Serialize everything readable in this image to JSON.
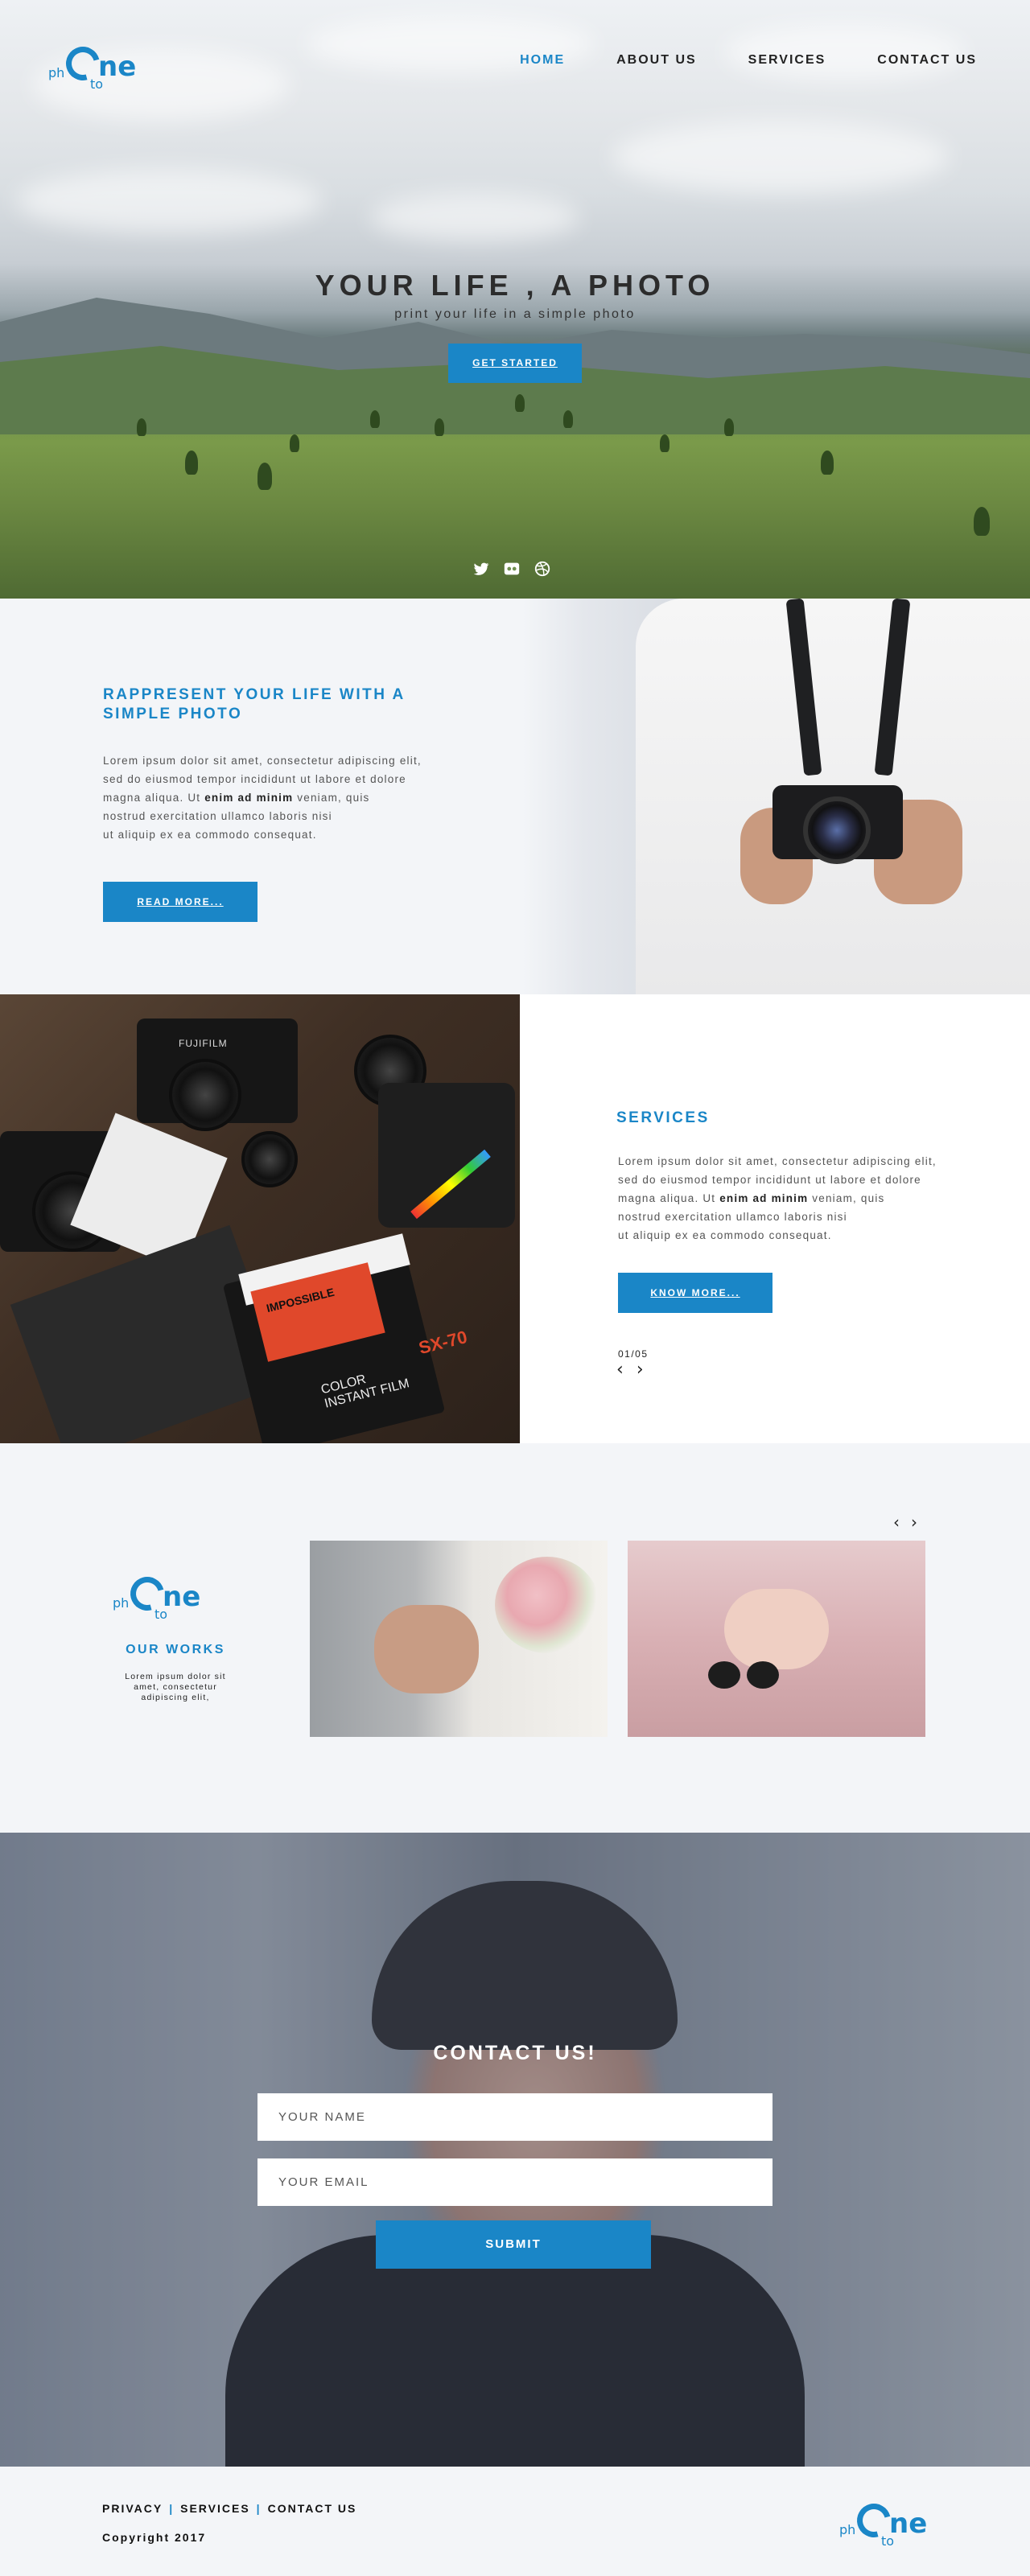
{
  "brand": {
    "logo_letters_main": "ne",
    "logo_ph": "ph",
    "logo_to": "to",
    "accent_color": "#1a86c7"
  },
  "nav": {
    "items": [
      {
        "label": "HOME",
        "active": true
      },
      {
        "label": "ABOUT US",
        "active": false
      },
      {
        "label": "SERVICES",
        "active": false
      },
      {
        "label": "CONTACT US",
        "active": false
      }
    ]
  },
  "hero": {
    "title": "YOUR LIFE , A PHOTO",
    "subtitle": "print your life in a simple photo",
    "cta": "GET STARTED",
    "social_icons": [
      "twitter-icon",
      "flickr-icon",
      "dribbble-icon"
    ]
  },
  "about": {
    "title": "RAPPRESENT YOUR LIFE WITH A SIMPLE PHOTO",
    "text_line1": "Lorem ipsum dolor sit amet, consectetur adipiscing elit,",
    "text_line2": "sed do eiusmod tempor incididunt ut labore et dolore",
    "text_line3_pre": "magna aliqua. Ut ",
    "text_line3_bold": "enim ad minim",
    "text_line3_post": " veniam, quis",
    "text_line4": "nostrud exercitation ullamco laboris nisi",
    "text_line5": "ut aliquip ex ea commodo consequat.",
    "button": "READ MORE..."
  },
  "services": {
    "title": "SERVICES",
    "text_line1": "Lorem ipsum dolor sit amet, consectetur adipiscing elit,",
    "text_line2": "sed do eiusmod tempor incididunt ut labore et dolore",
    "text_line3_pre": "magna aliqua. Ut ",
    "text_line3_bold": "enim ad minim",
    "text_line3_post": " veniam, quis",
    "text_line4": "nostrud exercitation ullamco laboris nisi",
    "text_line5": "ut aliquip ex ea commodo consequat.",
    "button": "KNOW MORE...",
    "pager": "01/05",
    "prev_arrow": "‹",
    "next_arrow": "›",
    "photo_labels": {
      "brand": "FUJIFILM",
      "film_brand": "IMPOSSIBLE",
      "film_model": "SX-70",
      "film_text": "COLOR INSTANT FILM"
    }
  },
  "works": {
    "title": "OUR WORKS",
    "text": "Lorem ipsum dolor sit amet, consectetur adipiscing elit,",
    "prev_arrow": "‹",
    "next_arrow": "›"
  },
  "contact": {
    "title": "CONTACT US!",
    "name_placeholder": "YOUR NAME",
    "email_placeholder": "YOUR EMAIL",
    "submit": "SUBMIT"
  },
  "footer": {
    "links": [
      "PRIVACY",
      "SERVICES",
      "CONTACT US"
    ],
    "separator": "|",
    "copyright": "Copyright 2017"
  }
}
